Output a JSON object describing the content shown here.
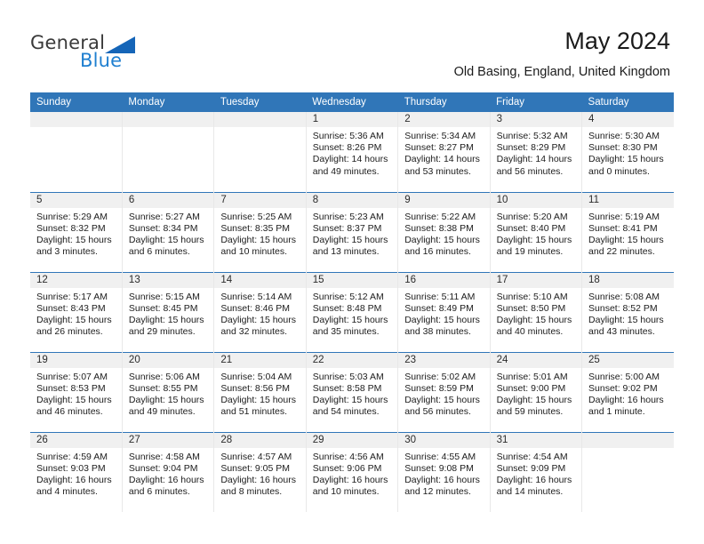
{
  "brand": {
    "name_top": "General",
    "name_bottom": "Blue",
    "color_primary": "#1565b8",
    "color_text": "#3a3a3a"
  },
  "header": {
    "title": "May 2024",
    "subtitle": "Old Basing, England, United Kingdom",
    "header_bg": "#3076b8",
    "daynum_bg": "#f0f0f0"
  },
  "calendar": {
    "weekday_headers": [
      "Sunday",
      "Monday",
      "Tuesday",
      "Wednesday",
      "Thursday",
      "Friday",
      "Saturday"
    ],
    "weeks": [
      [
        {
          "day": "",
          "empty": true,
          "sunrise": "",
          "sunset": "",
          "daylight_1": "",
          "daylight_2": ""
        },
        {
          "day": "",
          "empty": true,
          "sunrise": "",
          "sunset": "",
          "daylight_1": "",
          "daylight_2": ""
        },
        {
          "day": "",
          "empty": true,
          "sunrise": "",
          "sunset": "",
          "daylight_1": "",
          "daylight_2": ""
        },
        {
          "day": "1",
          "empty": false,
          "sunrise": "Sunrise: 5:36 AM",
          "sunset": "Sunset: 8:26 PM",
          "daylight_1": "Daylight: 14 hours",
          "daylight_2": "and 49 minutes."
        },
        {
          "day": "2",
          "empty": false,
          "sunrise": "Sunrise: 5:34 AM",
          "sunset": "Sunset: 8:27 PM",
          "daylight_1": "Daylight: 14 hours",
          "daylight_2": "and 53 minutes."
        },
        {
          "day": "3",
          "empty": false,
          "sunrise": "Sunrise: 5:32 AM",
          "sunset": "Sunset: 8:29 PM",
          "daylight_1": "Daylight: 14 hours",
          "daylight_2": "and 56 minutes."
        },
        {
          "day": "4",
          "empty": false,
          "sunrise": "Sunrise: 5:30 AM",
          "sunset": "Sunset: 8:30 PM",
          "daylight_1": "Daylight: 15 hours",
          "daylight_2": "and 0 minutes."
        }
      ],
      [
        {
          "day": "5",
          "empty": false,
          "sunrise": "Sunrise: 5:29 AM",
          "sunset": "Sunset: 8:32 PM",
          "daylight_1": "Daylight: 15 hours",
          "daylight_2": "and 3 minutes."
        },
        {
          "day": "6",
          "empty": false,
          "sunrise": "Sunrise: 5:27 AM",
          "sunset": "Sunset: 8:34 PM",
          "daylight_1": "Daylight: 15 hours",
          "daylight_2": "and 6 minutes."
        },
        {
          "day": "7",
          "empty": false,
          "sunrise": "Sunrise: 5:25 AM",
          "sunset": "Sunset: 8:35 PM",
          "daylight_1": "Daylight: 15 hours",
          "daylight_2": "and 10 minutes."
        },
        {
          "day": "8",
          "empty": false,
          "sunrise": "Sunrise: 5:23 AM",
          "sunset": "Sunset: 8:37 PM",
          "daylight_1": "Daylight: 15 hours",
          "daylight_2": "and 13 minutes."
        },
        {
          "day": "9",
          "empty": false,
          "sunrise": "Sunrise: 5:22 AM",
          "sunset": "Sunset: 8:38 PM",
          "daylight_1": "Daylight: 15 hours",
          "daylight_2": "and 16 minutes."
        },
        {
          "day": "10",
          "empty": false,
          "sunrise": "Sunrise: 5:20 AM",
          "sunset": "Sunset: 8:40 PM",
          "daylight_1": "Daylight: 15 hours",
          "daylight_2": "and 19 minutes."
        },
        {
          "day": "11",
          "empty": false,
          "sunrise": "Sunrise: 5:19 AM",
          "sunset": "Sunset: 8:41 PM",
          "daylight_1": "Daylight: 15 hours",
          "daylight_2": "and 22 minutes."
        }
      ],
      [
        {
          "day": "12",
          "empty": false,
          "sunrise": "Sunrise: 5:17 AM",
          "sunset": "Sunset: 8:43 PM",
          "daylight_1": "Daylight: 15 hours",
          "daylight_2": "and 26 minutes."
        },
        {
          "day": "13",
          "empty": false,
          "sunrise": "Sunrise: 5:15 AM",
          "sunset": "Sunset: 8:45 PM",
          "daylight_1": "Daylight: 15 hours",
          "daylight_2": "and 29 minutes."
        },
        {
          "day": "14",
          "empty": false,
          "sunrise": "Sunrise: 5:14 AM",
          "sunset": "Sunset: 8:46 PM",
          "daylight_1": "Daylight: 15 hours",
          "daylight_2": "and 32 minutes."
        },
        {
          "day": "15",
          "empty": false,
          "sunrise": "Sunrise: 5:12 AM",
          "sunset": "Sunset: 8:48 PM",
          "daylight_1": "Daylight: 15 hours",
          "daylight_2": "and 35 minutes."
        },
        {
          "day": "16",
          "empty": false,
          "sunrise": "Sunrise: 5:11 AM",
          "sunset": "Sunset: 8:49 PM",
          "daylight_1": "Daylight: 15 hours",
          "daylight_2": "and 38 minutes."
        },
        {
          "day": "17",
          "empty": false,
          "sunrise": "Sunrise: 5:10 AM",
          "sunset": "Sunset: 8:50 PM",
          "daylight_1": "Daylight: 15 hours",
          "daylight_2": "and 40 minutes."
        },
        {
          "day": "18",
          "empty": false,
          "sunrise": "Sunrise: 5:08 AM",
          "sunset": "Sunset: 8:52 PM",
          "daylight_1": "Daylight: 15 hours",
          "daylight_2": "and 43 minutes."
        }
      ],
      [
        {
          "day": "19",
          "empty": false,
          "sunrise": "Sunrise: 5:07 AM",
          "sunset": "Sunset: 8:53 PM",
          "daylight_1": "Daylight: 15 hours",
          "daylight_2": "and 46 minutes."
        },
        {
          "day": "20",
          "empty": false,
          "sunrise": "Sunrise: 5:06 AM",
          "sunset": "Sunset: 8:55 PM",
          "daylight_1": "Daylight: 15 hours",
          "daylight_2": "and 49 minutes."
        },
        {
          "day": "21",
          "empty": false,
          "sunrise": "Sunrise: 5:04 AM",
          "sunset": "Sunset: 8:56 PM",
          "daylight_1": "Daylight: 15 hours",
          "daylight_2": "and 51 minutes."
        },
        {
          "day": "22",
          "empty": false,
          "sunrise": "Sunrise: 5:03 AM",
          "sunset": "Sunset: 8:58 PM",
          "daylight_1": "Daylight: 15 hours",
          "daylight_2": "and 54 minutes."
        },
        {
          "day": "23",
          "empty": false,
          "sunrise": "Sunrise: 5:02 AM",
          "sunset": "Sunset: 8:59 PM",
          "daylight_1": "Daylight: 15 hours",
          "daylight_2": "and 56 minutes."
        },
        {
          "day": "24",
          "empty": false,
          "sunrise": "Sunrise: 5:01 AM",
          "sunset": "Sunset: 9:00 PM",
          "daylight_1": "Daylight: 15 hours",
          "daylight_2": "and 59 minutes."
        },
        {
          "day": "25",
          "empty": false,
          "sunrise": "Sunrise: 5:00 AM",
          "sunset": "Sunset: 9:02 PM",
          "daylight_1": "Daylight: 16 hours",
          "daylight_2": "and 1 minute."
        }
      ],
      [
        {
          "day": "26",
          "empty": false,
          "sunrise": "Sunrise: 4:59 AM",
          "sunset": "Sunset: 9:03 PM",
          "daylight_1": "Daylight: 16 hours",
          "daylight_2": "and 4 minutes."
        },
        {
          "day": "27",
          "empty": false,
          "sunrise": "Sunrise: 4:58 AM",
          "sunset": "Sunset: 9:04 PM",
          "daylight_1": "Daylight: 16 hours",
          "daylight_2": "and 6 minutes."
        },
        {
          "day": "28",
          "empty": false,
          "sunrise": "Sunrise: 4:57 AM",
          "sunset": "Sunset: 9:05 PM",
          "daylight_1": "Daylight: 16 hours",
          "daylight_2": "and 8 minutes."
        },
        {
          "day": "29",
          "empty": false,
          "sunrise": "Sunrise: 4:56 AM",
          "sunset": "Sunset: 9:06 PM",
          "daylight_1": "Daylight: 16 hours",
          "daylight_2": "and 10 minutes."
        },
        {
          "day": "30",
          "empty": false,
          "sunrise": "Sunrise: 4:55 AM",
          "sunset": "Sunset: 9:08 PM",
          "daylight_1": "Daylight: 16 hours",
          "daylight_2": "and 12 minutes."
        },
        {
          "day": "31",
          "empty": false,
          "sunrise": "Sunrise: 4:54 AM",
          "sunset": "Sunset: 9:09 PM",
          "daylight_1": "Daylight: 16 hours",
          "daylight_2": "and 14 minutes."
        },
        {
          "day": "",
          "empty": true,
          "sunrise": "",
          "sunset": "",
          "daylight_1": "",
          "daylight_2": ""
        }
      ]
    ]
  }
}
